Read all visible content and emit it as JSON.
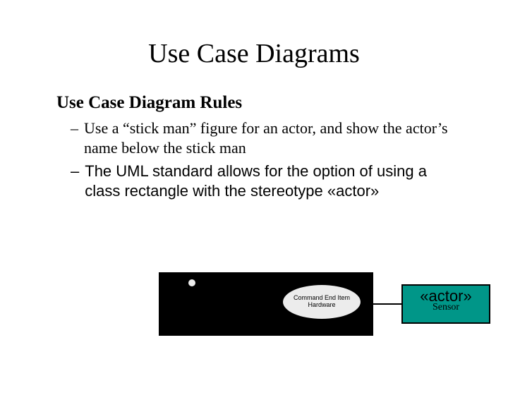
{
  "title": "Use Case Diagrams",
  "subtitle": "Use Case Diagram Rules",
  "bullets": [
    "Use a “stick man” figure for an actor, and show the actor’s name below the stick man",
    "The UML standard allows for the option of using a class rectangle with the stereotype «actor»"
  ],
  "oval_text": "Command End Item Hardware",
  "rect": {
    "stereotype": "«actor»",
    "name": "Sensor"
  }
}
